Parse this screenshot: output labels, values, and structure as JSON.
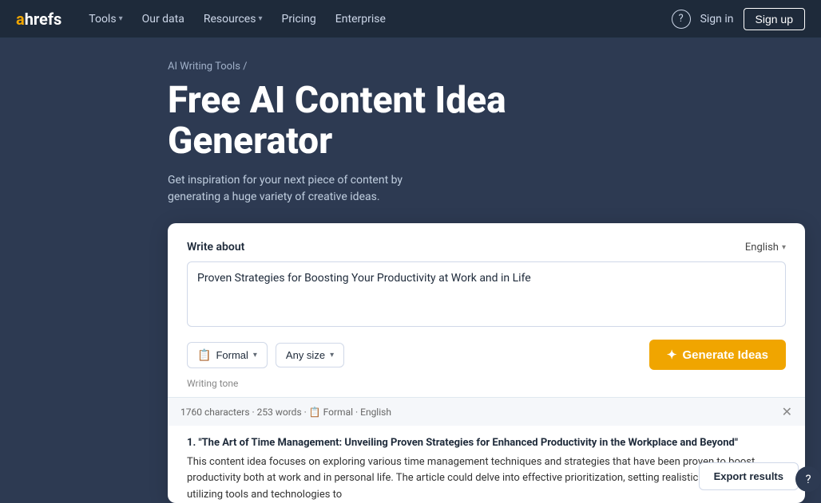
{
  "navbar": {
    "logo_a": "a",
    "logo_rest": "hrefs",
    "nav_items": [
      {
        "label": "Tools",
        "has_dropdown": true
      },
      {
        "label": "Our data",
        "has_dropdown": false
      },
      {
        "label": "Resources",
        "has_dropdown": true
      },
      {
        "label": "Pricing",
        "has_dropdown": false
      },
      {
        "label": "Enterprise",
        "has_dropdown": false
      }
    ],
    "help_icon": "?",
    "signin_label": "Sign in",
    "signup_label": "Sign up"
  },
  "breadcrumb": {
    "link_label": "AI Writing Tools",
    "separator": "/"
  },
  "hero": {
    "title": "Free AI Content Idea Generator",
    "subtitle": "Get inspiration for your next piece of content by generating a huge variety of creative ideas."
  },
  "card": {
    "write_about_label": "Write about",
    "language_label": "English",
    "textarea_value": "Proven Strategies for Boosting Your Productivity at Work and in Life",
    "textarea_placeholder": "Proven Strategies for Boosting Your Productivity at Work and in Life",
    "format_label": "Formal",
    "format_icon": "📋",
    "size_label": "Any size",
    "generate_icon": "✦",
    "generate_label": "Generate Ideas",
    "writing_tone_label": "Writing tone"
  },
  "results": {
    "stats": "1760 characters · 253 words · 📋 Formal · English",
    "item_number": "1.",
    "item_title": "\"The Art of Time Management: Unveiling Proven Strategies for Enhanced Productivity in the Workplace and Beyond\"",
    "item_body": "This content idea focuses on exploring various time management techniques and strategies that have been proven to boost productivity both at work and in personal life. The article could delve into effective prioritization, setting realistic goals, and utilizing tools and technologies to"
  },
  "export": {
    "export_label": "Export results"
  },
  "help_fab": "?"
}
